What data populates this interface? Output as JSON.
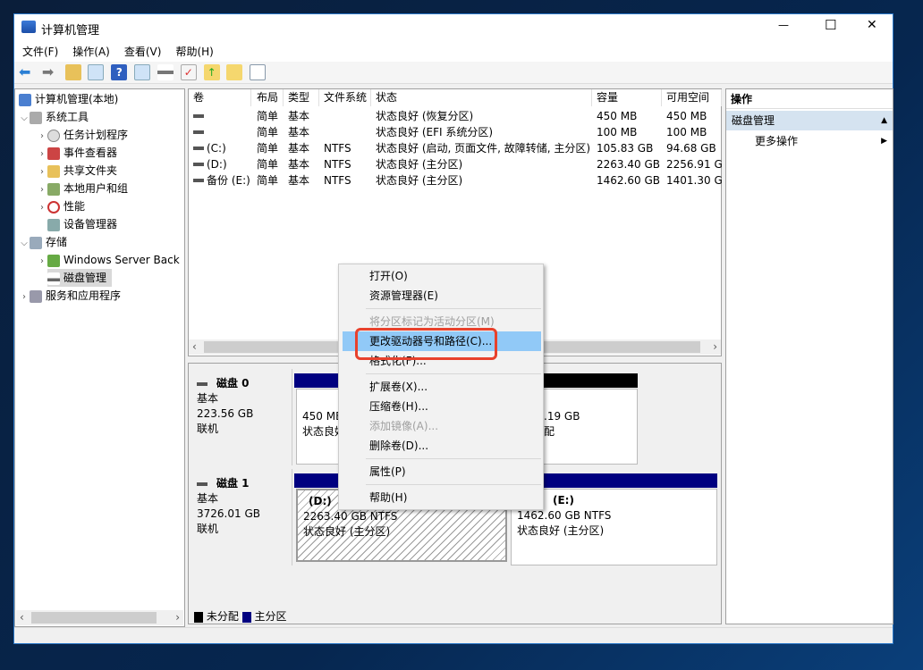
{
  "window": {
    "title": "计算机管理",
    "controls": {
      "minimize": "—",
      "maximize": "☐",
      "close": "✕"
    }
  },
  "menubar": [
    "文件(F)",
    "操作(A)",
    "查看(V)",
    "帮助(H)"
  ],
  "toolbar_icons": [
    "back-icon",
    "forward-icon",
    "up-folder-icon",
    "show-hide-tree-icon",
    "help-icon",
    "show-action-pane-icon",
    "connect-drive-icon",
    "checklist-icon",
    "export-icon",
    "search-folder-icon",
    "properties-list-icon"
  ],
  "tree": {
    "root": "计算机管理(本地)",
    "items": [
      {
        "label": "系统工具",
        "level": 1,
        "expanded": true
      },
      {
        "label": "任务计划程序",
        "level": 2
      },
      {
        "label": "事件查看器",
        "level": 2
      },
      {
        "label": "共享文件夹",
        "level": 2
      },
      {
        "label": "本地用户和组",
        "level": 2
      },
      {
        "label": "性能",
        "level": 2
      },
      {
        "label": "设备管理器",
        "level": 2
      },
      {
        "label": "存储",
        "level": 1,
        "expanded": true
      },
      {
        "label": "Windows Server Back",
        "level": 2
      },
      {
        "label": "磁盘管理",
        "level": 2,
        "selected": true
      },
      {
        "label": "服务和应用程序",
        "level": 1
      }
    ]
  },
  "volumes": {
    "columns": [
      "卷",
      "布局",
      "类型",
      "文件系统",
      "状态",
      "容量",
      "可用空间"
    ],
    "rows": [
      [
        "",
        "简单",
        "基本",
        "",
        "状态良好 (恢复分区)",
        "450 MB",
        "450 MB"
      ],
      [
        "",
        "简单",
        "基本",
        "",
        "状态良好 (EFI 系统分区)",
        "100 MB",
        "100 MB"
      ],
      [
        "(C:)",
        "简单",
        "基本",
        "NTFS",
        "状态良好 (启动, 页面文件, 故障转储, 主分区)",
        "105.83 GB",
        "94.68 GB"
      ],
      [
        "(D:)",
        "简单",
        "基本",
        "NTFS",
        "状态良好 (主分区)",
        "2263.40 GB",
        "2256.91 G"
      ],
      [
        "备份 (E:)",
        "简单",
        "基本",
        "NTFS",
        "状态良好 (主分区)",
        "1462.60 GB",
        "1401.30 G"
      ]
    ]
  },
  "disks": [
    {
      "name": "磁盘 0",
      "type": "基本",
      "size": "223.56 GB",
      "status": "联机",
      "partitions": [
        {
          "line1": "450 MB",
          "line2": "状态良好"
        },
        {
          "line1": ".19 GB",
          "line2": "配"
        }
      ]
    },
    {
      "name": "磁盘 1",
      "type": "基本",
      "size": "3726.01 GB",
      "status": "联机",
      "partitions": [
        {
          "title": "(D:)",
          "line1": "2263.40 GB NTFS",
          "line2": "状态良好 (主分区)"
        },
        {
          "title": "(E:)",
          "line1": "1462.60 GB NTFS",
          "line2": "状态良好 (主分区)"
        }
      ]
    }
  ],
  "legend": [
    {
      "label": "未分配",
      "color": "#000000"
    },
    {
      "label": "主分区",
      "color": "#000080"
    }
  ],
  "actions": {
    "header": "操作",
    "section": "磁盘管理",
    "more": "更多操作"
  },
  "context_menu": [
    {
      "label": "打开(O)",
      "enabled": true
    },
    {
      "label": "资源管理器(E)",
      "enabled": true
    },
    {
      "label": "将分区标记为活动分区(M)",
      "enabled": false
    },
    {
      "label": "更改驱动器号和路径(C)...",
      "enabled": true,
      "highlighted": true
    },
    {
      "label": "格式化(F)...",
      "enabled": true
    },
    {
      "label": "扩展卷(X)...",
      "enabled": true
    },
    {
      "label": "压缩卷(H)...",
      "enabled": true
    },
    {
      "label": "添加镜像(A)...",
      "enabled": false
    },
    {
      "label": "删除卷(D)...",
      "enabled": true
    },
    {
      "label": "属性(P)",
      "enabled": true
    },
    {
      "label": "帮助(H)",
      "enabled": true
    }
  ],
  "colors": {
    "primary_partition": "#000080",
    "unallocated": "#000000",
    "highlight": "#91c9f7",
    "annotation": "#e8412c"
  }
}
